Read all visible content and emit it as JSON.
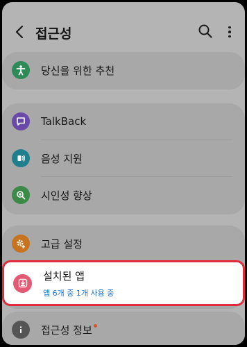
{
  "header": {
    "title": "접근성",
    "back_icon": "chevron-left-icon",
    "search_icon": "search-icon",
    "more_icon": "more-vertical-icon"
  },
  "sections": {
    "recommended": {
      "label": "당신을 위한 추천",
      "icon": "accessibility-person-icon",
      "color": "#2e8b57"
    },
    "vision": [
      {
        "label": "TalkBack",
        "icon": "chat-bubble-icon",
        "color": "#6a4aa8"
      },
      {
        "label": "음성 지원",
        "icon": "voice-assist-icon",
        "color": "#1f7f8c"
      },
      {
        "label": "시인성 향상",
        "icon": "magnify-plus-icon",
        "color": "#3b8a48"
      }
    ],
    "advanced": {
      "label": "고급 설정",
      "icon": "gear-plus-icon",
      "color": "#c7731f"
    },
    "installed_apps": {
      "label": "설치된 앱",
      "sublabel": "앱 6개 중 1개 사용 중",
      "icon": "download-app-icon",
      "color": "#e55a73",
      "sublabel_color": "#1a73c8",
      "highlight_color": "#e02b3a"
    },
    "about": {
      "label": "접근성 정보",
      "icon": "info-icon",
      "color": "#555555",
      "badge_color": "#d9532b"
    }
  }
}
